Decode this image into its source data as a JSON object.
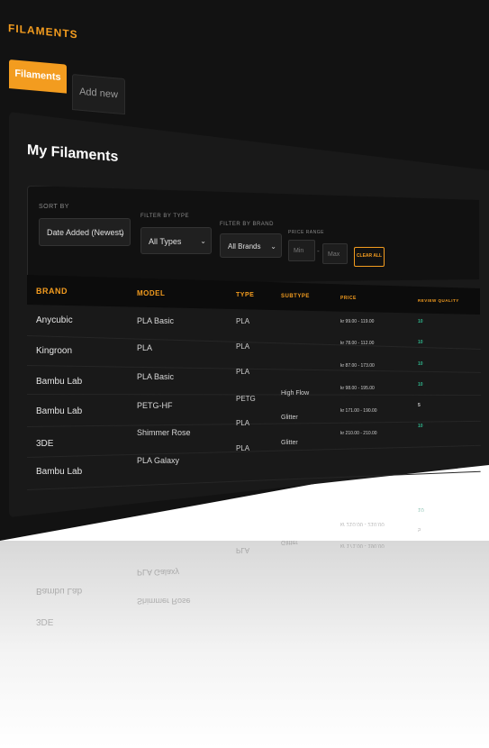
{
  "app": {
    "title": "FILAMENTS"
  },
  "tabs": [
    {
      "label": "Filaments",
      "active": true
    },
    {
      "label": "Add new",
      "active": false
    }
  ],
  "page": {
    "heading": "My Filaments"
  },
  "filters": {
    "sort_by": {
      "label": "SORT BY",
      "value": "Date Added (Newest)"
    },
    "filter_type": {
      "label": "FILTER BY TYPE",
      "value": "All Types"
    },
    "filter_brand": {
      "label": "FILTER BY BRAND",
      "value": "All Brands"
    },
    "price_range": {
      "label": "PRICE RANGE",
      "min_placeholder": "Min",
      "max_placeholder": "Max",
      "separator": "-"
    },
    "clear_label": "CLEAR ALL"
  },
  "table": {
    "headers": {
      "brand": "BRAND",
      "model": "MODEL",
      "type": "TYPE",
      "subtype": "SUBTYPE",
      "price": "PRICE",
      "review": "REVIEW QUALITY"
    },
    "rows": [
      {
        "brand": "Anycubic",
        "model": "PLA Basic",
        "type": "PLA",
        "subtype": "",
        "price": "kr 99.00 - 119.00",
        "review": "10"
      },
      {
        "brand": "Kingroon",
        "model": "PLA",
        "type": "PLA",
        "subtype": "",
        "price": "kr 78.00 - 112.00",
        "review": "10"
      },
      {
        "brand": "Bambu Lab",
        "model": "PLA Basic",
        "type": "PLA",
        "subtype": "",
        "price": "kr 87.00 - 173.00",
        "review": "10"
      },
      {
        "brand": "Bambu Lab",
        "model": "PETG-HF",
        "type": "PETG",
        "subtype": "High Flow",
        "price": "kr 98.00 - 195.00",
        "review": "10"
      },
      {
        "brand": "3DE",
        "model": "Shimmer Rose",
        "type": "PLA",
        "subtype": "Glitter",
        "price": "kr 171.00 - 190.00",
        "review": "5"
      },
      {
        "brand": "Bambu Lab",
        "model": "PLA Galaxy",
        "type": "PLA",
        "subtype": "Glitter",
        "price": "kr 210.00 - 210.00",
        "review": "10"
      }
    ]
  },
  "colors": {
    "accent": "#f39c1f",
    "background": "#121212",
    "card": "#191919",
    "review_good": "#2fb58c"
  }
}
